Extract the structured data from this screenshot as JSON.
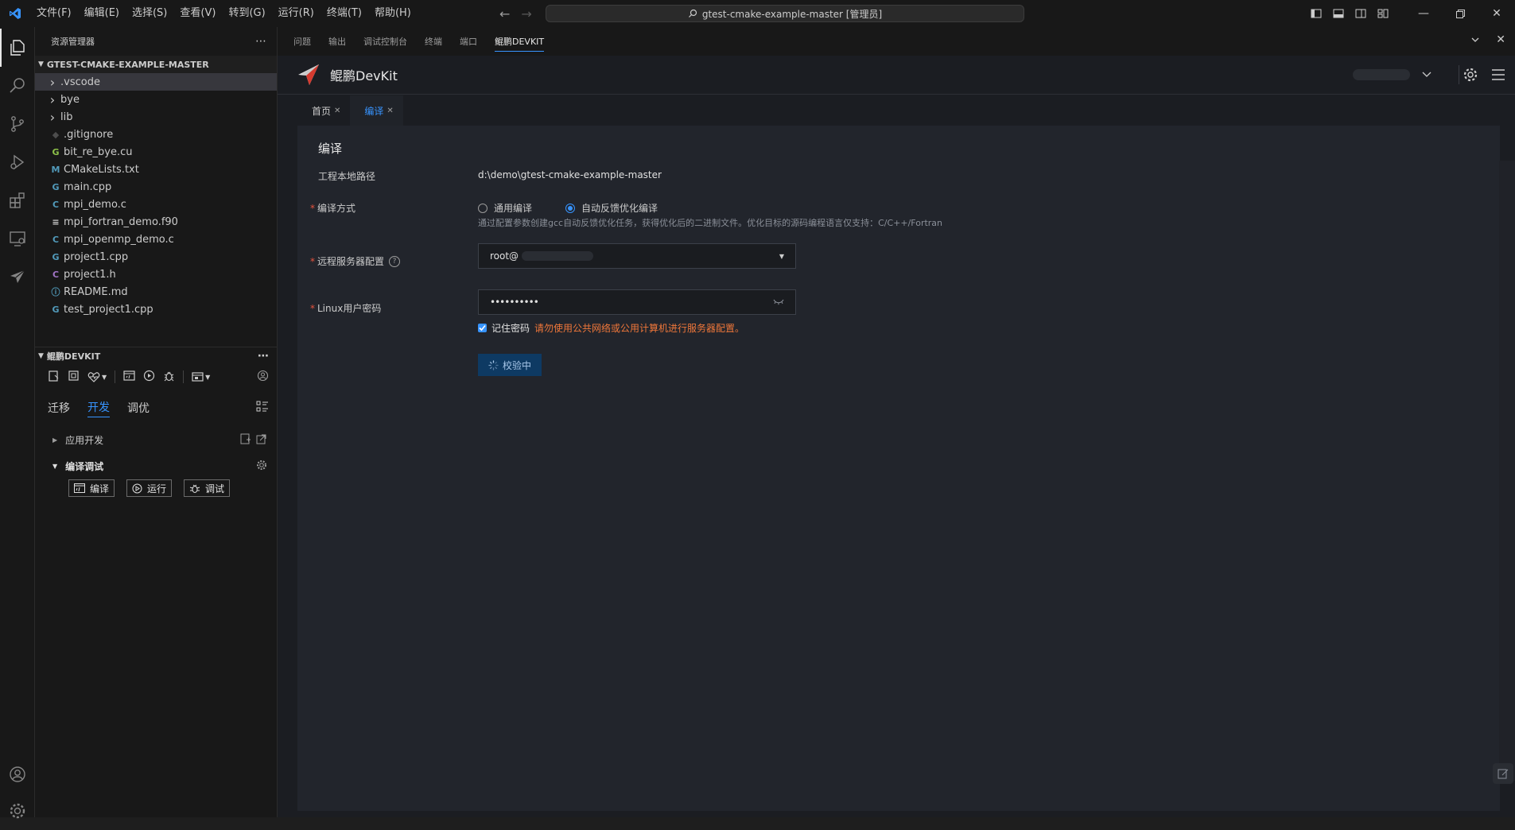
{
  "titlebar": {
    "menu": [
      "文件(F)",
      "编辑(E)",
      "选择(S)",
      "查看(V)",
      "转到(G)",
      "运行(R)",
      "终端(T)",
      "帮助(H)"
    ],
    "search": "gtest-cmake-example-master [管理员]"
  },
  "sidebar": {
    "explorer_title": "资源管理器",
    "folder_name": "GTEST-CMAKE-EXAMPLE-MASTER",
    "files": [
      {
        "name": ".vscode",
        "icon": "chevron-right-icon",
        "type": "folder"
      },
      {
        "name": "bye",
        "icon": "chevron-right-icon",
        "type": "folder"
      },
      {
        "name": "lib",
        "icon": "chevron-right-icon",
        "type": "folder"
      },
      {
        "name": ".gitignore",
        "icon": "gitignore-icon",
        "type": "file"
      },
      {
        "name": "bit_re_bye.cu",
        "icon": "cuda-file-icon",
        "type": "file"
      },
      {
        "name": "CMakeLists.txt",
        "icon": "cmake-file-icon",
        "type": "file"
      },
      {
        "name": "main.cpp",
        "icon": "cpp-file-icon",
        "type": "file"
      },
      {
        "name": "mpi_demo.c",
        "icon": "c-file-icon",
        "type": "file"
      },
      {
        "name": "mpi_fortran_demo.f90",
        "icon": "fortran-file-icon",
        "type": "file"
      },
      {
        "name": "mpi_openmp_demo.c",
        "icon": "c-file-icon",
        "type": "file"
      },
      {
        "name": "project1.cpp",
        "icon": "cpp-file-icon",
        "type": "file"
      },
      {
        "name": "project1.h",
        "icon": "header-file-icon",
        "type": "file"
      },
      {
        "name": "README.md",
        "icon": "info-file-icon",
        "type": "file"
      },
      {
        "name": "test_project1.cpp",
        "icon": "cpp-file-icon",
        "type": "file"
      }
    ],
    "devkit_title": "鲲鹏DEVKIT",
    "devkit_tabs": [
      "迁移",
      "开发",
      "调优"
    ],
    "active_tab": "开发",
    "app_dev_label": "应用开发",
    "compile_debug_label": "编译调试",
    "buttons": {
      "compile": "编译",
      "run": "运行",
      "debug": "调试"
    }
  },
  "panel": {
    "tabs": [
      "问题",
      "输出",
      "调试控制台",
      "终端",
      "端口",
      "鲲鹏DEVKIT"
    ],
    "active_tab": "鲲鹏DEVKIT"
  },
  "devkit": {
    "title": "鲲鹏DevKit",
    "editor_tabs": [
      {
        "label": "首页",
        "active": false
      },
      {
        "label": "编译",
        "active": true
      }
    ],
    "form": {
      "heading": "编译",
      "path_label": "工程本地路径",
      "path_value": "d:\\demo\\gtest-cmake-example-master",
      "mode_label": "编译方式",
      "mode_options": [
        "通用编译",
        "自动反馈优化编译"
      ],
      "mode_selected": "自动反馈优化编译",
      "mode_hint": "通过配置参数创建gcc自动反馈优化任务，获得优化后的二进制文件。优化目标的源码编程语言仅支持：C/C++/Fortran",
      "server_label": "远程服务器配置",
      "server_value": "root@",
      "password_label": "Linux用户密码",
      "password_value": "••••••••••",
      "remember_label": "记住密码",
      "remember_checked": true,
      "remember_warning": "请勿使用公共网络或公用计算机进行服务器配置。",
      "verify_button": "校验中"
    }
  },
  "colors": {
    "accent": "#3794ff",
    "warning": "#f0773a",
    "required": "#e5533d",
    "button_bg": "#0e3a63"
  }
}
